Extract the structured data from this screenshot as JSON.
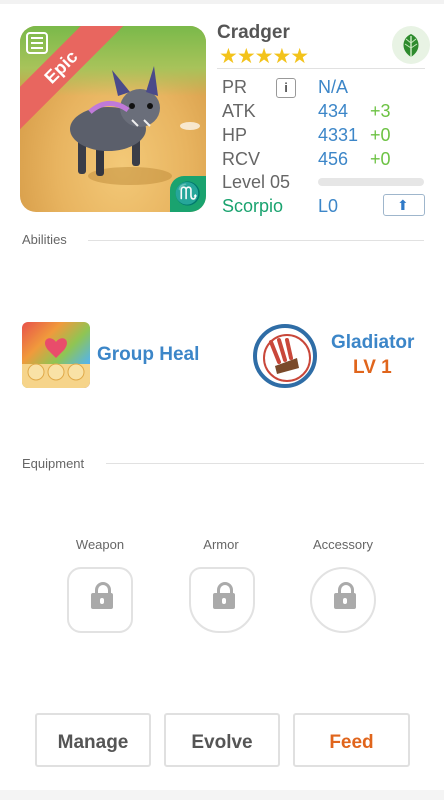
{
  "monster": {
    "name": "Cradger",
    "rarity": "Epic",
    "stars": "★★★★★",
    "zodiac_symbol": "♏",
    "element_icon": "leaf-icon"
  },
  "stats": {
    "pr": {
      "label": "PR",
      "value": "N/A",
      "info_icon": "i"
    },
    "atk": {
      "label": "ATK",
      "value": "434",
      "bonus": "+3"
    },
    "hp": {
      "label": "HP",
      "value": "4331",
      "bonus": "+0"
    },
    "rcv": {
      "label": "RCV",
      "value": "456",
      "bonus": "+0"
    },
    "level": {
      "label": "Level 05",
      "progress": 0
    },
    "zodiac": {
      "label": "Scorpio",
      "value": "L0",
      "upgrade_icon": "⬆"
    }
  },
  "abilities": {
    "title": "Abilities",
    "items": [
      {
        "name": "Group Heal"
      },
      {
        "name": "Gladiator",
        "level": "LV 1"
      }
    ]
  },
  "equipment": {
    "title": "Equipment",
    "slots": [
      {
        "label": "Weapon"
      },
      {
        "label": "Armor"
      },
      {
        "label": "Accessory"
      }
    ]
  },
  "actions": {
    "manage": "Manage",
    "evolve": "Evolve",
    "feed": "Feed"
  },
  "colors": {
    "accent_blue": "#3c86c8",
    "orange": "#e0651c",
    "green": "#6cc243",
    "scorpio_green": "#1aa36f",
    "epic_red": "#e8665f"
  }
}
